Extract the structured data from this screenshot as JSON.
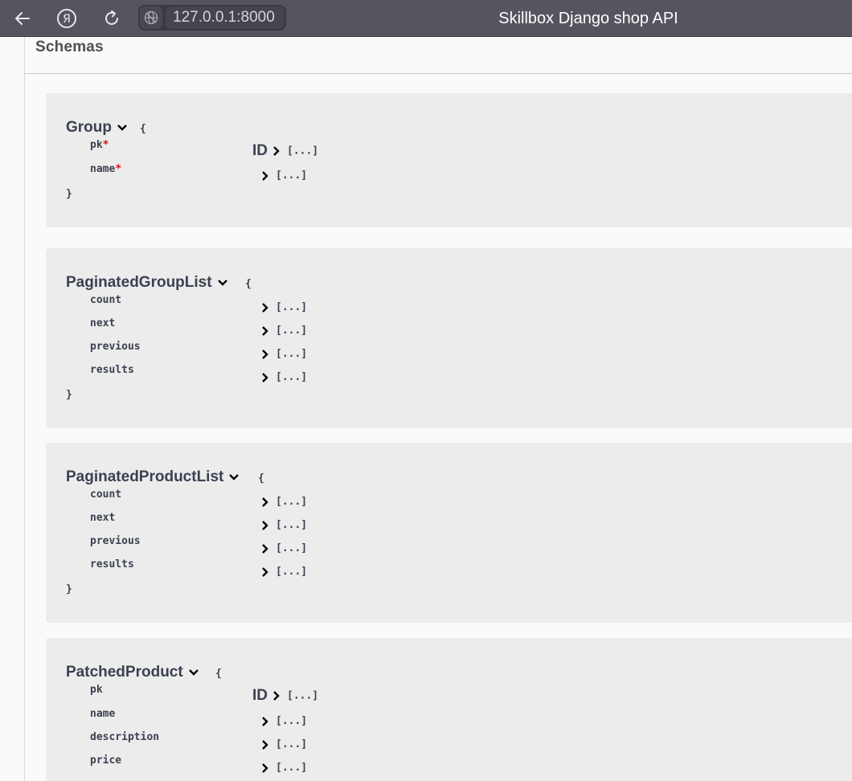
{
  "browser": {
    "url": "127.0.0.1:8000",
    "title": "Skillbox Django shop API",
    "icons": [
      "back-arrow-icon",
      "yandex-icon",
      "reload-icon",
      "globe-icon"
    ]
  },
  "schemas": {
    "title": "Schemas",
    "models": [
      {
        "name": "Group",
        "open_brace": "{",
        "close_brace": "}",
        "properties": [
          {
            "name": "pk",
            "required": "*",
            "type_label": "ID",
            "value": "[...]"
          },
          {
            "name": "name",
            "required": "*",
            "type_label": "",
            "value": "[...]"
          }
        ]
      },
      {
        "name": "PaginatedGroupList",
        "open_brace": "{",
        "close_brace": "}",
        "properties": [
          {
            "name": "count",
            "value": "[...]"
          },
          {
            "name": "next",
            "value": "[...]"
          },
          {
            "name": "previous",
            "value": "[...]"
          },
          {
            "name": "results",
            "value": "[...]"
          }
        ]
      },
      {
        "name": "PaginatedProductList",
        "open_brace": "{",
        "close_brace": "}",
        "properties": [
          {
            "name": "count",
            "value": "[...]"
          },
          {
            "name": "next",
            "value": "[...]"
          },
          {
            "name": "previous",
            "value": "[...]"
          },
          {
            "name": "results",
            "value": "[...]"
          }
        ]
      },
      {
        "name": "PatchedProduct",
        "open_brace": "{",
        "properties": [
          {
            "name": "pk",
            "type_label": "ID",
            "value": "[...]"
          },
          {
            "name": "name",
            "value": "[...]"
          },
          {
            "name": "description",
            "value": "[...]"
          },
          {
            "name": "price",
            "value": "[...]"
          }
        ]
      }
    ]
  },
  "colors": {
    "toolbar": "#56555f",
    "panel": "#ececec",
    "text": "#3b4151",
    "required": "#dd1111"
  }
}
